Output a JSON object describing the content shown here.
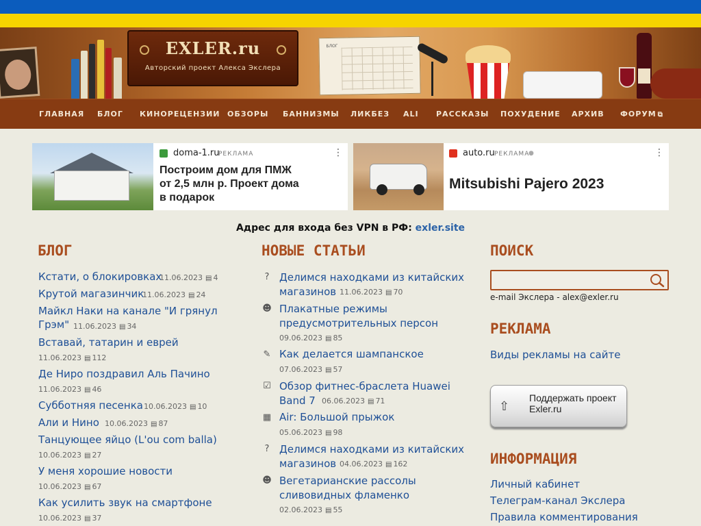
{
  "site": {
    "logo": "EXLER.ru",
    "tagline": "Авторский проект Алекса Экслера",
    "calendar_label": "БЛОГ"
  },
  "nav": [
    "ГЛАВНАЯ",
    "БЛОГ",
    "КИНОРЕЦЕНЗИИ",
    "ОБЗОРЫ",
    "БАННИЗМЫ",
    "ЛИКБЕЗ",
    "ALI",
    "РАССКАЗЫ",
    "ПОХУДЕНИЕ",
    "АРХИВ",
    "ФОРУМ"
  ],
  "ads": [
    {
      "domain": "doma-1.ru",
      "tag": "РЕКЛАМА",
      "title_lines": [
        "Построим дом для ПМЖ",
        "от 2,5 млн р. Проект дома",
        "в подарок"
      ],
      "favicon_color": "#3c9a3c"
    },
    {
      "domain": "auto.ru",
      "tag": "РЕКЛАМА",
      "title": "Mitsubishi Pajero 2023",
      "favicon_color": "#e0301e"
    }
  ],
  "vpn": {
    "label": "Адрес для входа без VPN в РФ:",
    "link": "exler.site"
  },
  "blog": {
    "heading": "БЛОГ",
    "items": [
      {
        "title": "Кстати, о блокировках",
        "date": "11.06.2023",
        "comments": "4"
      },
      {
        "title": "Крутой магазинчик",
        "date": "11.06.2023",
        "comments": "24"
      },
      {
        "title": "Майкл Наки на канале \"И грянул Грэм\"",
        "title_lines": [
          "Майкл Наки на канале \"И грянул",
          "Грэм\""
        ],
        "date": "11.06.2023",
        "comments": "34"
      },
      {
        "title": "Вставай, татарин и еврей",
        "date": "11.06.2023",
        "comments": "112"
      },
      {
        "title": "Де Ниро поздравил Аль Пачино",
        "date": "11.06.2023",
        "comments": "46"
      },
      {
        "title": "Субботняя песенка",
        "date": "10.06.2023",
        "comments": "10"
      },
      {
        "title": "Али и Нино",
        "date": "10.06.2023",
        "comments": "87"
      },
      {
        "title": "Танцующее яйцо (L'ou com balla)",
        "date": "10.06.2023",
        "comments": "27"
      },
      {
        "title": "У меня хорошие новости",
        "date": "10.06.2023",
        "comments": "67"
      },
      {
        "title": "Как усилить звук на смартфоне",
        "date": "10.06.2023",
        "comments": "37"
      }
    ]
  },
  "articles": {
    "heading": "НОВЫЕ СТАТЬИ",
    "items": [
      {
        "icon": "question-bubble-icon",
        "glyph": "?",
        "lines": [
          "Делимся находками из китайских",
          "магазинов"
        ],
        "date": "11.06.2023",
        "comments": "70"
      },
      {
        "icon": "smiley-icon",
        "glyph": "☻",
        "lines": [
          "Плакатные режимы",
          "предусмотрительных персон"
        ],
        "date": "09.06.2023",
        "comments": "85"
      },
      {
        "icon": "pencil-icon",
        "glyph": "✎",
        "lines": [
          "Как делается шампанское"
        ],
        "date": "07.06.2023",
        "comments": "57"
      },
      {
        "icon": "clipboard-check-icon",
        "glyph": "☑",
        "lines": [
          "Обзор фитнес-браслета Huawei",
          "Band 7"
        ],
        "date": "06.06.2023",
        "comments": "71"
      },
      {
        "icon": "clapperboard-icon",
        "glyph": "▦",
        "lines": [
          "Air: Большой прыжок"
        ],
        "date": "05.06.2023",
        "comments": "98"
      },
      {
        "icon": "question-bubble-icon",
        "glyph": "?",
        "lines": [
          "Делимся находками из китайских",
          "магазинов"
        ],
        "date": "04.06.2023",
        "comments": "162"
      },
      {
        "icon": "smiley-icon",
        "glyph": "☻",
        "lines": [
          "Вегетарианские рассолы",
          "сливовидных фламенко"
        ],
        "date": "02.06.2023",
        "comments": "55"
      }
    ]
  },
  "sidebar": {
    "search_heading": "ПОИСК",
    "search_value": "",
    "email_text": "e-mail Экслера - alex@exler.ru",
    "ads_heading": "РЕКЛАМА",
    "ads_link": "Виды рекламы на сайте",
    "support_label": "Поддержать проект Exler.ru",
    "info_heading": "ИНФОРМАЦИЯ",
    "info_links": [
      "Личный кабинет",
      "Телеграм-канал Экслера",
      "Правила комментирования"
    ]
  },
  "colors": {
    "nav_bg": "#873b12",
    "heading": "#a94d1f",
    "link": "#1e4f96",
    "flag_blue": "#0b5cbd",
    "flag_yellow": "#f6d400"
  }
}
